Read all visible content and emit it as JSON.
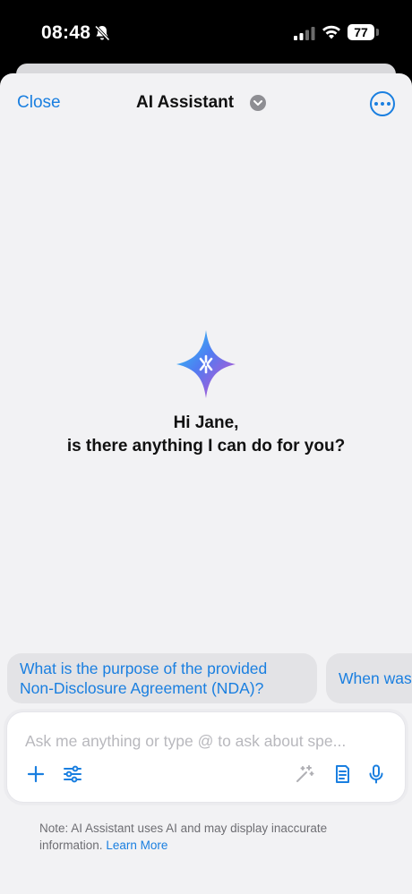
{
  "status_bar": {
    "time": "08:48",
    "battery": "77"
  },
  "nav": {
    "close_label": "Close",
    "title": "AI Assistant"
  },
  "greeting": {
    "line1": "Hi Jane,",
    "line2": "is there anything I can do for you?"
  },
  "suggestions": [
    {
      "line1": "What is the purpose of the provided",
      "line2": "Non-Disclosure Agreement (NDA)?"
    },
    {
      "line1": "When was"
    }
  ],
  "composer": {
    "placeholder": "Ask me anything or type @ to ask about spe..."
  },
  "footer": {
    "note": "Note: AI Assistant uses AI and may display inaccurate information.",
    "link": "Learn More"
  },
  "colors": {
    "accent": "#1a7fe0",
    "sheet_background": "#f2f2f4"
  },
  "icons": [
    "bell-slash-icon",
    "cellular-signal-icon",
    "wifi-icon",
    "battery-icon",
    "chevron-down-icon",
    "more-icon",
    "sparkle-logo-icon",
    "plus-icon",
    "sliders-icon",
    "magic-wand-icon",
    "document-icon",
    "microphone-icon"
  ]
}
